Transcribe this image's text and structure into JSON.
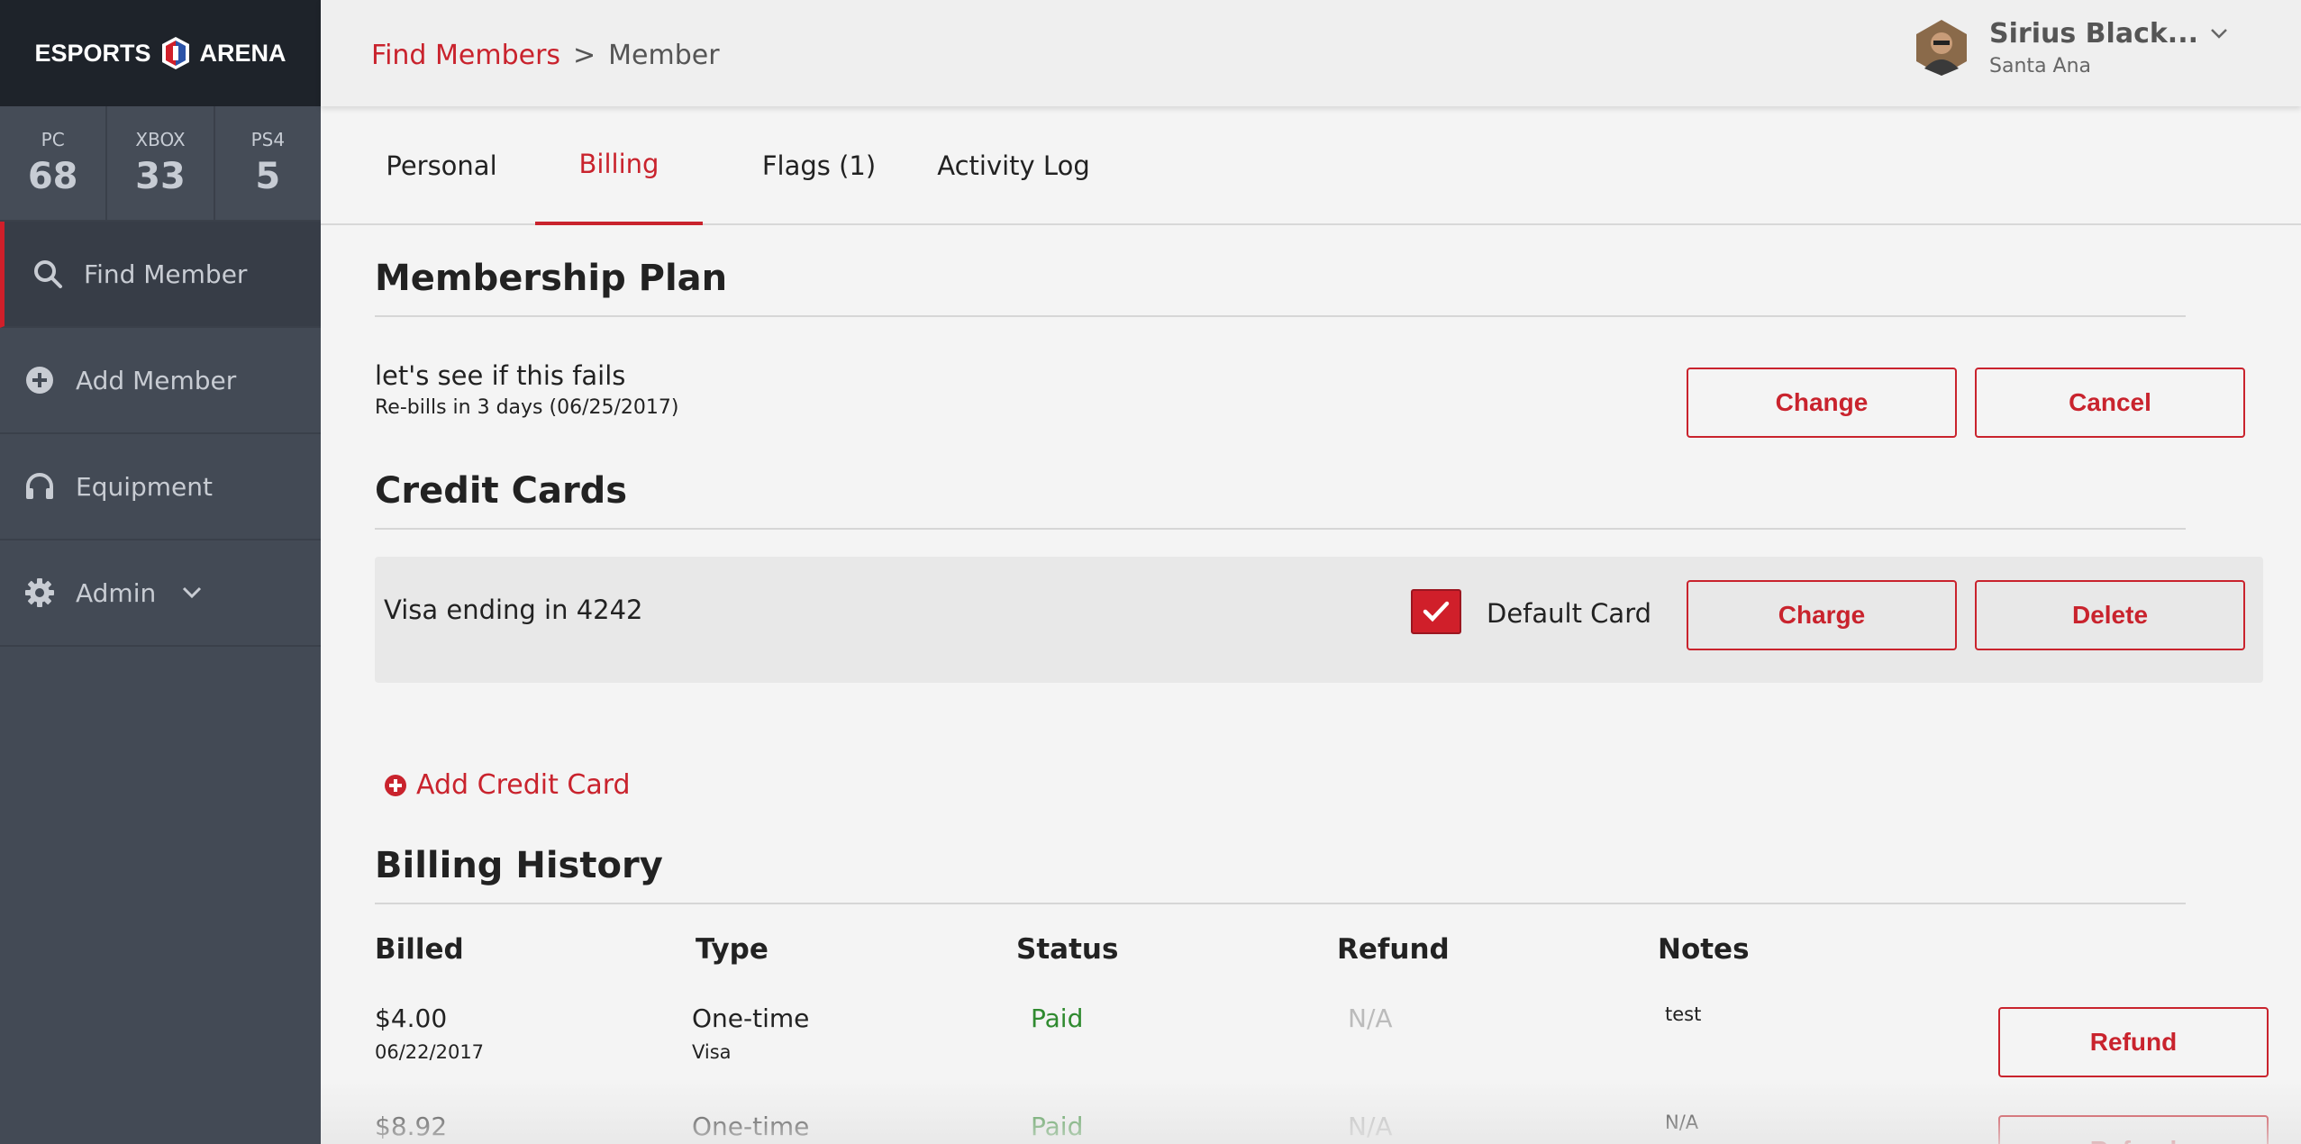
{
  "brand": {
    "name_left": "ESPORTS",
    "name_right": "ARENA"
  },
  "stats": [
    {
      "label": "PC",
      "value": "68"
    },
    {
      "label": "XBOX",
      "value": "33"
    },
    {
      "label": "PS4",
      "value": "5"
    }
  ],
  "nav": {
    "find_member": "Find Member",
    "add_member": "Add Member",
    "equipment": "Equipment",
    "admin": "Admin"
  },
  "breadcrumb": {
    "link": "Find Members",
    "separator": ">",
    "current": "Member"
  },
  "user": {
    "name": "Sirius Black...",
    "location": "Santa Ana"
  },
  "tabs": [
    {
      "label": "Personal"
    },
    {
      "label": "Billing"
    },
    {
      "label": "Flags (1)"
    },
    {
      "label": "Activity Log"
    }
  ],
  "membership": {
    "title": "Membership Plan",
    "plan_name": "let's see if this fails",
    "rebill": "Re-bills in 3 days (06/25/2017)",
    "change_label": "Change",
    "cancel_label": "Cancel"
  },
  "credit_cards": {
    "title": "Credit Cards",
    "card_label": "Visa ending in 4242",
    "default_label": "Default Card",
    "default_checked": true,
    "charge_label": "Charge",
    "delete_label": "Delete",
    "add_label": "Add Credit Card"
  },
  "billing_history": {
    "title": "Billing History",
    "headers": {
      "billed": "Billed",
      "type": "Type",
      "status": "Status",
      "refund": "Refund",
      "notes": "Notes"
    },
    "rows": [
      {
        "amount": "$4.00",
        "date": "06/22/2017",
        "type": "One-time",
        "method": "Visa",
        "status": "Paid",
        "refund": "N/A",
        "notes": "test",
        "action": "Refund"
      },
      {
        "amount": "$8.92",
        "date": "",
        "type": "One-time",
        "method": "",
        "status": "Paid",
        "refund": "N/A",
        "notes": "N/A",
        "action": "Refund"
      }
    ]
  },
  "colors": {
    "accent": "#c9232d",
    "sidebar": "#434a55",
    "paid": "#2f8a2f"
  }
}
